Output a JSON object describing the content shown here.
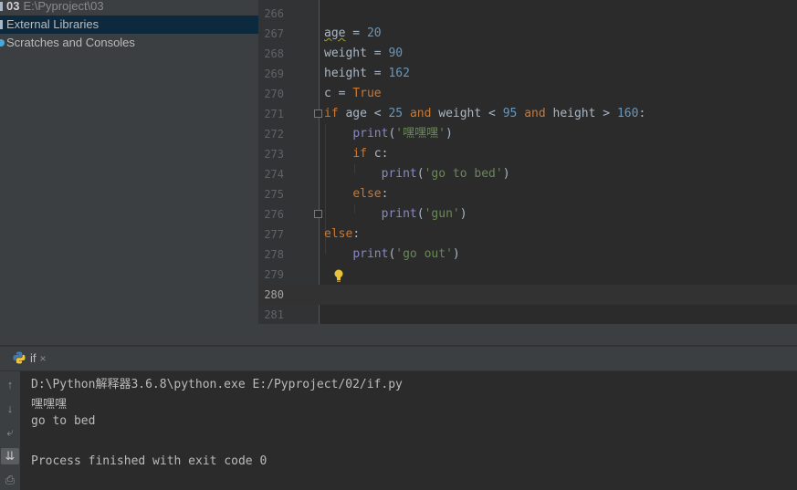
{
  "project_tree": {
    "project": {
      "name": "03",
      "path": "E:\\Pyproject\\03"
    },
    "external_libraries": "External Libraries",
    "scratches": "Scratches and Consoles"
  },
  "editor": {
    "lines": [
      {
        "num": "266",
        "tokens": []
      },
      {
        "num": "267",
        "tokens": [
          {
            "t": "age",
            "c": "wavy"
          },
          {
            "t": " = "
          },
          {
            "t": "20",
            "c": "num"
          }
        ]
      },
      {
        "num": "268",
        "tokens": [
          {
            "t": "weight = "
          },
          {
            "t": "90",
            "c": "num"
          }
        ]
      },
      {
        "num": "269",
        "tokens": [
          {
            "t": "height = "
          },
          {
            "t": "162",
            "c": "num"
          }
        ]
      },
      {
        "num": "270",
        "tokens": [
          {
            "t": "c = "
          },
          {
            "t": "True",
            "c": "kw"
          }
        ]
      },
      {
        "num": "271",
        "fold": true,
        "tokens": [
          {
            "t": "if",
            "c": "kw"
          },
          {
            "t": " age < "
          },
          {
            "t": "25",
            "c": "num"
          },
          {
            "t": " "
          },
          {
            "t": "and",
            "c": "kw"
          },
          {
            "t": " weight < "
          },
          {
            "t": "95",
            "c": "num"
          },
          {
            "t": " "
          },
          {
            "t": "and",
            "c": "kw"
          },
          {
            "t": " height > "
          },
          {
            "t": "160",
            "c": "num"
          },
          {
            "t": ":"
          }
        ]
      },
      {
        "num": "272",
        "tokens": [
          {
            "t": "    "
          },
          {
            "t": "print",
            "c": "bi"
          },
          {
            "t": "("
          },
          {
            "t": "'嘿嘿嘿'",
            "c": "str"
          },
          {
            "t": ")"
          }
        ]
      },
      {
        "num": "273",
        "tokens": [
          {
            "t": "    "
          },
          {
            "t": "if",
            "c": "kw"
          },
          {
            "t": " c:"
          }
        ]
      },
      {
        "num": "274",
        "tokens": [
          {
            "t": "        "
          },
          {
            "t": "print",
            "c": "bi"
          },
          {
            "t": "("
          },
          {
            "t": "'go to bed'",
            "c": "str"
          },
          {
            "t": ")"
          }
        ]
      },
      {
        "num": "275",
        "tokens": [
          {
            "t": "    "
          },
          {
            "t": "else",
            "c": "kw"
          },
          {
            "t": ":"
          }
        ]
      },
      {
        "num": "276",
        "fold": true,
        "tokens": [
          {
            "t": "        "
          },
          {
            "t": "print",
            "c": "bi"
          },
          {
            "t": "("
          },
          {
            "t": "'gun'",
            "c": "str"
          },
          {
            "t": ")"
          }
        ]
      },
      {
        "num": "277",
        "tokens": [
          {
            "t": "else",
            "c": "kw"
          },
          {
            "t": ":"
          }
        ]
      },
      {
        "num": "278",
        "tokens": [
          {
            "t": "    "
          },
          {
            "t": "print",
            "c": "bi"
          },
          {
            "t": "("
          },
          {
            "t": "'go out'",
            "c": "str"
          },
          {
            "t": ")"
          }
        ]
      },
      {
        "num": "279",
        "bulb": true,
        "tokens": []
      },
      {
        "num": "280",
        "caret": true,
        "tokens": []
      },
      {
        "num": "281",
        "tokens": []
      }
    ]
  },
  "run_panel": {
    "tab_label": "if",
    "tab_icon": "python-icon",
    "close_glyph": "×",
    "toolbar": [
      {
        "name": "up-arrow-icon",
        "glyph": "↑"
      },
      {
        "name": "down-arrow-icon",
        "glyph": "↓"
      },
      {
        "name": "soft-wrap-icon",
        "glyph": "⤶"
      },
      {
        "name": "scroll-to-end-icon",
        "glyph": "⇊",
        "active": true
      },
      {
        "name": "print-icon",
        "glyph": "⎙"
      }
    ],
    "output": [
      "D:\\Python解释器3.6.8\\python.exe E:/Pyproject/02/if.py",
      "嘿嘿嘿",
      "go to bed",
      "",
      "Process finished with exit code 0"
    ]
  }
}
